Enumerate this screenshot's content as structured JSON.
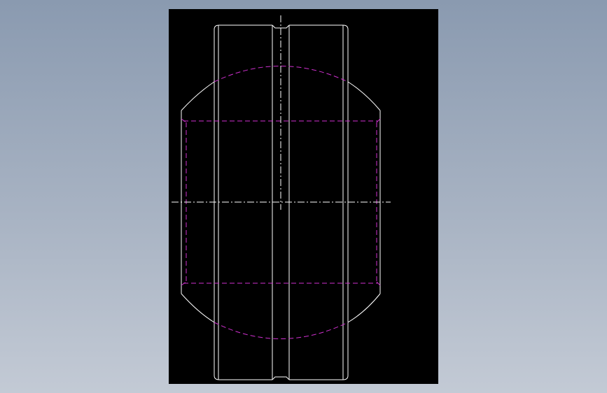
{
  "colors": {
    "background_gradient_top": "#8a9ab0",
    "background_gradient_bottom": "#c3cad5",
    "viewport_background": "#000000",
    "outline_stroke": "#ffffff",
    "hidden_stroke": "#d030d0",
    "centerline_stroke": "#ffffff"
  }
}
